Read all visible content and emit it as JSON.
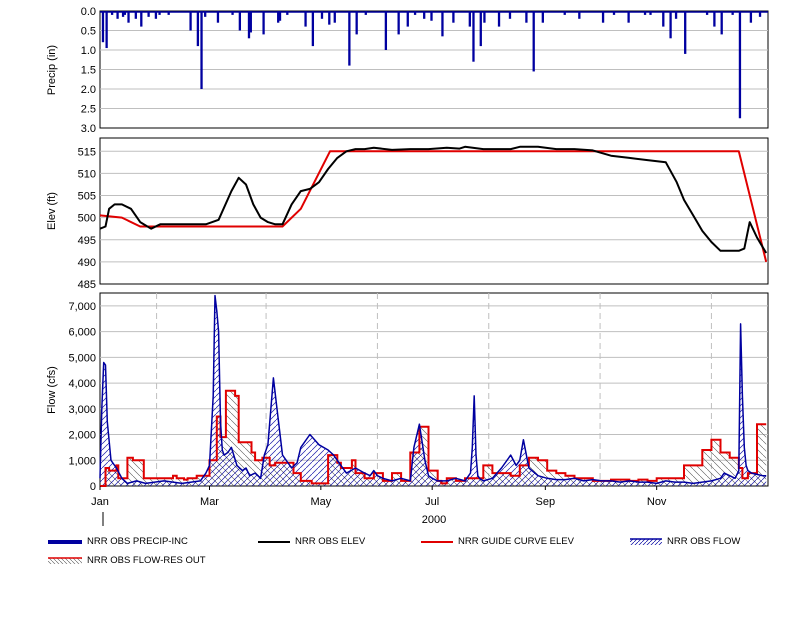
{
  "chart_data": [
    {
      "type": "bar",
      "ylabel": "Precip (in)",
      "y_ticks": [
        "0.0",
        "0.5",
        "1.0",
        "1.5",
        "2.0",
        "2.5",
        "3.0"
      ],
      "ylim": [
        3.0,
        0.0
      ],
      "inverted_y": true,
      "grid": true,
      "series": [
        {
          "name": "NRR OBS PRECIP-INC",
          "color": "#0000a0",
          "x_day": [
            1,
            3,
            6,
            9,
            12,
            13,
            15,
            19,
            22,
            26,
            30,
            32,
            37,
            49,
            53,
            55,
            57,
            64,
            72,
            76,
            81,
            82,
            89,
            97,
            98,
            102,
            112,
            116,
            121,
            125,
            128,
            136,
            140,
            145,
            156,
            163,
            168,
            172,
            177,
            181,
            187,
            193,
            202,
            204,
            208,
            210,
            218,
            224,
            233,
            237,
            242,
            254,
            262,
            275,
            281,
            289,
            298,
            301,
            308,
            312,
            315,
            320,
            332,
            336,
            340,
            346,
            350,
            356,
            361
          ],
          "values": [
            0.8,
            0.95,
            0.1,
            0.2,
            0.15,
            0.1,
            0.3,
            0.2,
            0.4,
            0.15,
            0.2,
            0.1,
            0.1,
            0.5,
            0.9,
            2.0,
            0.15,
            0.3,
            0.1,
            0.5,
            0.7,
            0.55,
            0.6,
            0.3,
            0.25,
            0.1,
            0.4,
            0.9,
            0.2,
            0.35,
            0.3,
            1.4,
            0.6,
            0.1,
            1.0,
            0.6,
            0.4,
            0.1,
            0.2,
            0.25,
            0.65,
            0.3,
            0.4,
            1.3,
            0.9,
            0.3,
            0.4,
            0.2,
            0.3,
            1.55,
            0.3,
            0.1,
            0.2,
            0.3,
            0.1,
            0.3,
            0.1,
            0.1,
            0.4,
            0.7,
            0.2,
            1.1,
            0.1,
            0.4,
            0.6,
            0.1,
            2.75,
            0.3,
            0.15
          ]
        }
      ]
    },
    {
      "type": "line",
      "ylabel": "Elev (ft)",
      "y_ticks": [
        "515",
        "510",
        "505",
        "500",
        "495",
        "490",
        "485"
      ],
      "ylim": [
        485,
        518
      ],
      "grid": true,
      "series": [
        {
          "name": "NRR OBS ELEV",
          "color": "#000000",
          "x_day": [
            0,
            3,
            5,
            8,
            12,
            17,
            22,
            28,
            33,
            40,
            50,
            58,
            65,
            72,
            76,
            80,
            84,
            88,
            92,
            96,
            100,
            105,
            110,
            115,
            120,
            125,
            130,
            135,
            140,
            145,
            150,
            160,
            170,
            180,
            190,
            197,
            200,
            210,
            220,
            225,
            230,
            240,
            250,
            260,
            270,
            280,
            290,
            300,
            310,
            316,
            320,
            325,
            330,
            335,
            340,
            345,
            350,
            353,
            356,
            360,
            365
          ],
          "values": [
            497.5,
            498.0,
            502.0,
            503.0,
            503.0,
            502.0,
            499.0,
            497.5,
            498.5,
            498.5,
            498.5,
            498.5,
            499.5,
            506.0,
            509.0,
            507.5,
            503.0,
            500.0,
            499.0,
            498.5,
            498.5,
            503.0,
            506.0,
            506.5,
            508.0,
            511.0,
            513.5,
            515.0,
            515.5,
            515.5,
            515.8,
            515.3,
            515.5,
            515.5,
            515.8,
            515.6,
            516.0,
            515.5,
            515.5,
            515.5,
            516.0,
            516.0,
            515.5,
            515.5,
            515.2,
            514.0,
            513.5,
            513.0,
            512.5,
            508.0,
            504.0,
            500.5,
            497.0,
            494.5,
            492.5,
            492.5,
            492.5,
            493.0,
            499.0,
            495.5,
            492.0
          ]
        },
        {
          "name": "NRR GUIDE CURVE ELEV",
          "color": "#e00000",
          "x_day": [
            0,
            12,
            22,
            70,
            100,
            110,
            126,
            350,
            365
          ],
          "values": [
            500.5,
            500.0,
            498.0,
            498.0,
            498.0,
            502.0,
            515.0,
            515.0,
            490.0
          ]
        }
      ]
    },
    {
      "type": "line",
      "ylabel": "Flow (cfs)",
      "xlabel": "2000",
      "x_ticks": [
        "Jan",
        "Mar",
        "May",
        "Jul",
        "Sep",
        "Nov"
      ],
      "y_ticks": [
        "7,000",
        "6,000",
        "5,000",
        "4,000",
        "3,000",
        "2,000",
        "1,000",
        "0"
      ],
      "ylim": [
        0,
        7500
      ],
      "grid": true,
      "series": [
        {
          "name": "NRR OBS FLOW",
          "color": "#0000a0",
          "x_day": [
            0,
            1,
            2,
            3,
            4,
            6,
            9,
            12,
            15,
            20,
            25,
            30,
            35,
            40,
            45,
            50,
            55,
            58,
            60,
            62,
            63,
            64,
            65,
            66,
            67,
            68,
            70,
            72,
            75,
            78,
            80,
            82,
            85,
            88,
            90,
            92,
            95,
            97,
            100,
            105,
            108,
            110,
            115,
            120,
            125,
            128,
            132,
            135,
            140,
            145,
            148,
            150,
            152,
            155,
            160,
            165,
            170,
            172,
            175,
            178,
            180,
            182,
            185,
            190,
            195,
            200,
            203,
            204,
            205,
            206,
            207,
            208,
            210,
            215,
            220,
            225,
            228,
            230,
            232,
            235,
            240,
            245,
            250,
            255,
            260,
            265,
            270,
            275,
            280,
            285,
            290,
            295,
            300,
            305,
            310,
            315,
            320,
            325,
            330,
            335,
            340,
            342,
            345,
            348,
            350,
            351,
            352,
            353,
            354,
            355,
            357,
            360,
            363,
            365
          ],
          "values": [
            300,
            3000,
            4800,
            4700,
            2500,
            1000,
            700,
            300,
            100,
            200,
            100,
            150,
            200,
            150,
            100,
            150,
            200,
            500,
            800,
            3500,
            7400,
            6800,
            6000,
            2500,
            1400,
            1200,
            1300,
            1500,
            800,
            600,
            700,
            400,
            500,
            300,
            1200,
            1600,
            4200,
            3000,
            1200,
            700,
            900,
            1500,
            2000,
            1600,
            1400,
            1200,
            800,
            500,
            700,
            500,
            400,
            600,
            400,
            300,
            200,
            300,
            200,
            1500,
            2400,
            1000,
            400,
            300,
            200,
            200,
            300,
            200,
            500,
            1500,
            3500,
            1200,
            400,
            300,
            200,
            300,
            700,
            1200,
            800,
            1000,
            1800,
            700,
            400,
            300,
            250,
            250,
            300,
            200,
            250,
            200,
            200,
            150,
            200,
            150,
            150,
            100,
            200,
            150,
            150,
            100,
            150,
            200,
            300,
            500,
            400,
            300,
            600,
            6300,
            3500,
            1500,
            800,
            600,
            500,
            450,
            400,
            400
          ]
        },
        {
          "name": "NRR OBS FLOW-RES OUT",
          "color": "#e00000",
          "x_day": [
            0,
            3,
            3,
            5,
            5,
            9,
            9,
            10,
            10,
            15,
            15,
            18,
            18,
            24,
            24,
            40,
            40,
            42,
            42,
            46,
            46,
            48,
            48,
            53,
            53,
            60,
            60,
            64,
            64,
            66,
            66,
            69,
            69,
            74,
            74,
            76,
            76,
            83,
            83,
            85,
            85,
            89,
            89,
            93,
            93,
            96,
            96,
            106,
            106,
            110,
            110,
            116,
            116,
            125,
            125,
            130,
            130,
            132,
            132,
            138,
            138,
            140,
            140,
            145,
            145,
            150,
            150,
            155,
            155,
            160,
            160,
            165,
            165,
            170,
            170,
            175,
            175,
            180,
            180,
            185,
            185,
            187,
            187,
            190,
            190,
            195,
            195,
            200,
            200,
            210,
            210,
            215,
            215,
            225,
            225,
            230,
            230,
            235,
            235,
            240,
            240,
            245,
            245,
            250,
            250,
            255,
            255,
            260,
            260,
            270,
            270,
            280,
            280,
            290,
            290,
            295,
            295,
            300,
            300,
            305,
            305,
            315,
            315,
            320,
            320,
            330,
            330,
            335,
            335,
            340,
            340,
            345,
            345,
            350,
            350,
            352,
            352,
            355,
            355,
            360,
            360,
            365
          ],
          "values": [
            0,
            0,
            700,
            700,
            600,
            600,
            800,
            800,
            300,
            300,
            1100,
            1100,
            1000,
            1000,
            300,
            300,
            400,
            400,
            300,
            300,
            250,
            250,
            300,
            300,
            400,
            400,
            1000,
            1000,
            2700,
            2700,
            1900,
            1900,
            3700,
            3700,
            3500,
            3500,
            1700,
            1700,
            1300,
            1300,
            1000,
            1000,
            1100,
            1100,
            800,
            800,
            900,
            900,
            500,
            500,
            200,
            200,
            100,
            100,
            1200,
            1200,
            900,
            900,
            700,
            700,
            1000,
            1000,
            500,
            500,
            300,
            300,
            500,
            500,
            200,
            200,
            500,
            500,
            200,
            200,
            1300,
            1300,
            2300,
            2300,
            600,
            600,
            200,
            200,
            100,
            100,
            300,
            300,
            200,
            200,
            300,
            300,
            800,
            800,
            500,
            500,
            400,
            400,
            800,
            800,
            1100,
            1100,
            1000,
            1000,
            600,
            600,
            500,
            500,
            400,
            400,
            300,
            300,
            200,
            200,
            250,
            250,
            200,
            200,
            250,
            250,
            200,
            200,
            300,
            300,
            300,
            300,
            800,
            800,
            1400,
            1400,
            1800,
            1800,
            1300,
            1300,
            1100,
            1100,
            700,
            700,
            300,
            300,
            500,
            500,
            2400,
            2400,
            2500,
            2500,
            100,
            100
          ]
        }
      ]
    }
  ],
  "legend": {
    "precip": "NRR OBS PRECIP-INC",
    "elev": "NRR OBS ELEV",
    "guide": "NRR GUIDE CURVE ELEV",
    "flow": "NRR OBS FLOW",
    "resout": "NRR OBS FLOW-RES OUT"
  },
  "colors": {
    "precip": "#0000a0",
    "elev": "#000000",
    "guide": "#e00000",
    "flow": "#0000a0",
    "resout": "#e00000",
    "grid": "#bfbfbf"
  }
}
